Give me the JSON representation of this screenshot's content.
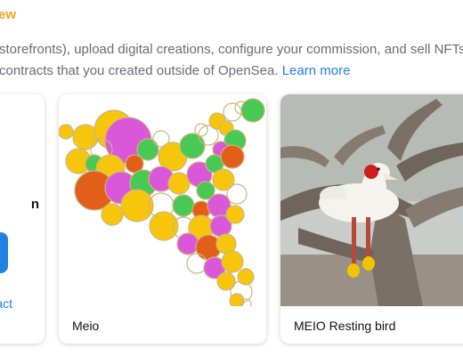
{
  "header": {
    "title": "ew"
  },
  "description": {
    "line1": "storefronts), upload digital creations, configure your commission, and sell NFTs to",
    "line2": "contracts that you created outside of OpenSea.",
    "learn_more": "Learn more"
  },
  "cards": {
    "create": {
      "title": "n",
      "link": "act"
    },
    "meio": {
      "title": "Meio",
      "image": "generative-circles-art"
    },
    "bird": {
      "title": "MEIO Resting bird",
      "image": "white-bird-plush-photo"
    }
  },
  "colors": {
    "accent_orange": "#f5a623",
    "link_blue": "#2081e2",
    "art_yellow": "#f7c400",
    "art_magenta": "#d94fd9",
    "art_green": "#3ec74a",
    "art_orange": "#e2560c"
  }
}
